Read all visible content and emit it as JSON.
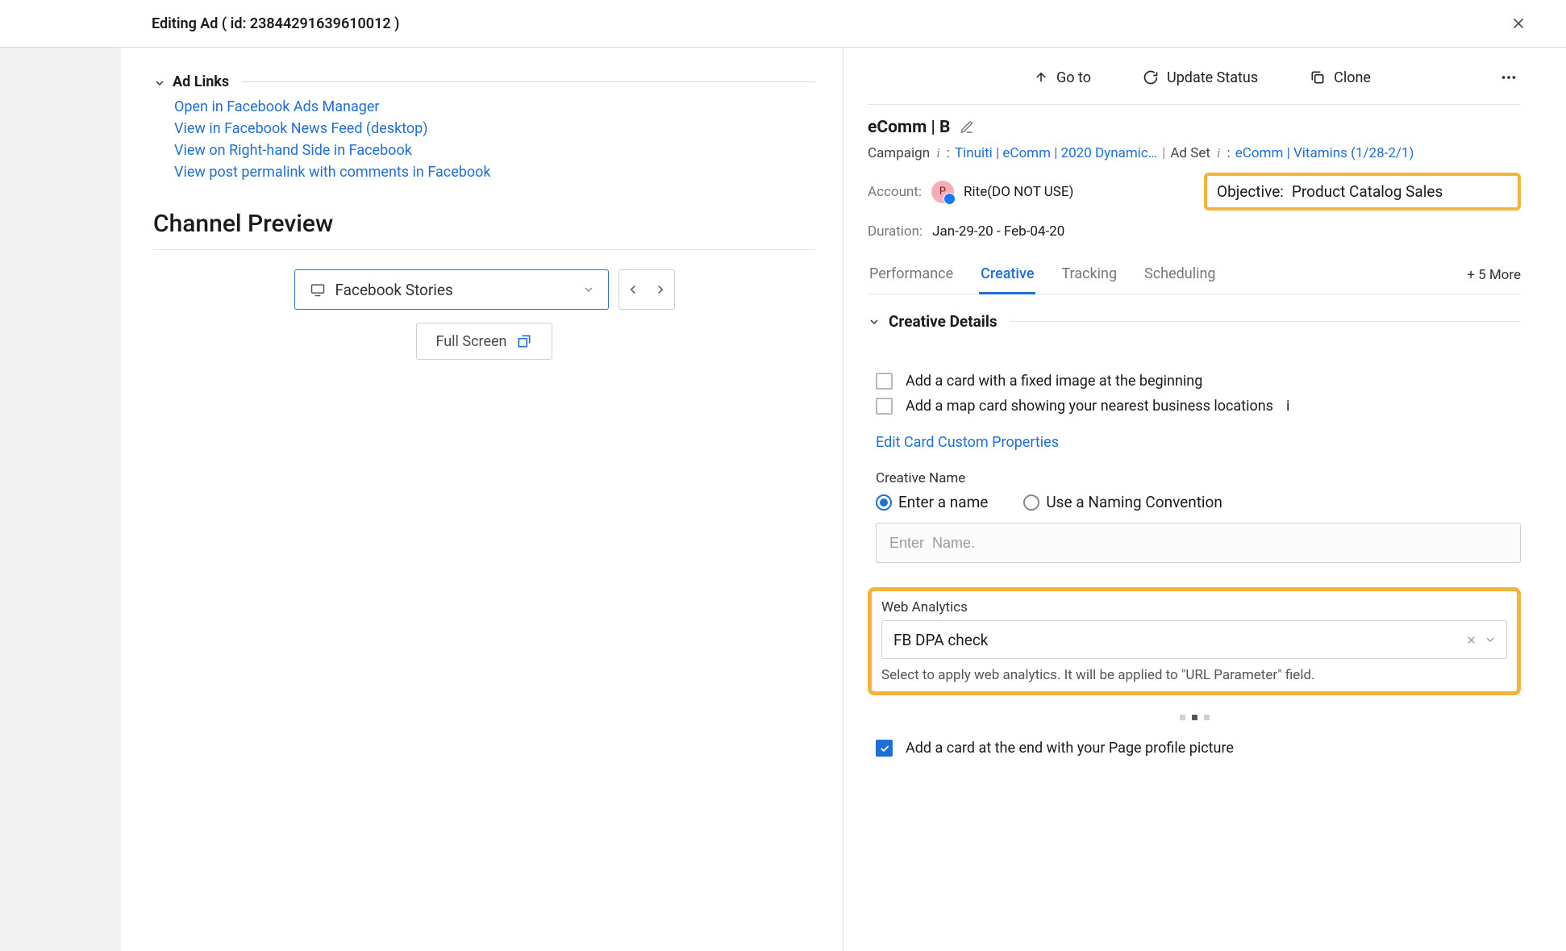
{
  "header": {
    "title": "Editing Ad ( id: 23844291639610012 )"
  },
  "leftPanel": {
    "adLinks": {
      "title": "Ad Links",
      "links": [
        "Open in Facebook Ads Manager",
        "View in Facebook News Feed (desktop)",
        "View on Right-hand Side in Facebook",
        "View post permalink with comments in Facebook"
      ]
    },
    "channelPreview": {
      "heading": "Channel Preview",
      "placementSelect": "Facebook Stories",
      "fullScreen": "Full Screen"
    }
  },
  "rightPanel": {
    "actions": {
      "goto": "Go to",
      "updateStatus": "Update Status",
      "clone": "Clone"
    },
    "entityName": "eComm | B",
    "breadcrumb": {
      "campaignLabel": "Campaign",
      "campaignLink": "Tinuiti | eComm | 2020 Dynamic…",
      "adsetLabel": "Ad Set",
      "adsetLink": "eComm | Vitamins (1/28-2/1)"
    },
    "meta": {
      "accountLabel": "Account:",
      "accountValue": "Rite(DO NOT USE)",
      "objectiveLabel": "Objective:",
      "objectiveValue": "Product Catalog Sales",
      "durationLabel": "Duration:",
      "durationValue": "Jan-29-20 - Feb-04-20"
    },
    "tabs": {
      "performance": "Performance",
      "creative": "Creative",
      "tracking": "Tracking",
      "scheduling": "Scheduling",
      "more": "+ 5 More"
    },
    "creativeDetails": {
      "title": "Creative Details",
      "cardFixed": "Add a card with a fixed image at the beginning",
      "cardMap": "Add a map card showing your nearest business locations",
      "editCardProps": "Edit Card Custom Properties",
      "creativeNameLabel": "Creative Name",
      "radioEnter": "Enter a name",
      "radioConvention": "Use a Naming Convention",
      "namePlaceholder": "Enter  Name.",
      "webAnalytics": {
        "label": "Web Analytics",
        "value": "FB DPA check",
        "hint": "Select to apply web analytics. It will be applied to \"URL Parameter\" field."
      },
      "cardEnd": "Add a card at the end with your Page profile picture"
    }
  }
}
